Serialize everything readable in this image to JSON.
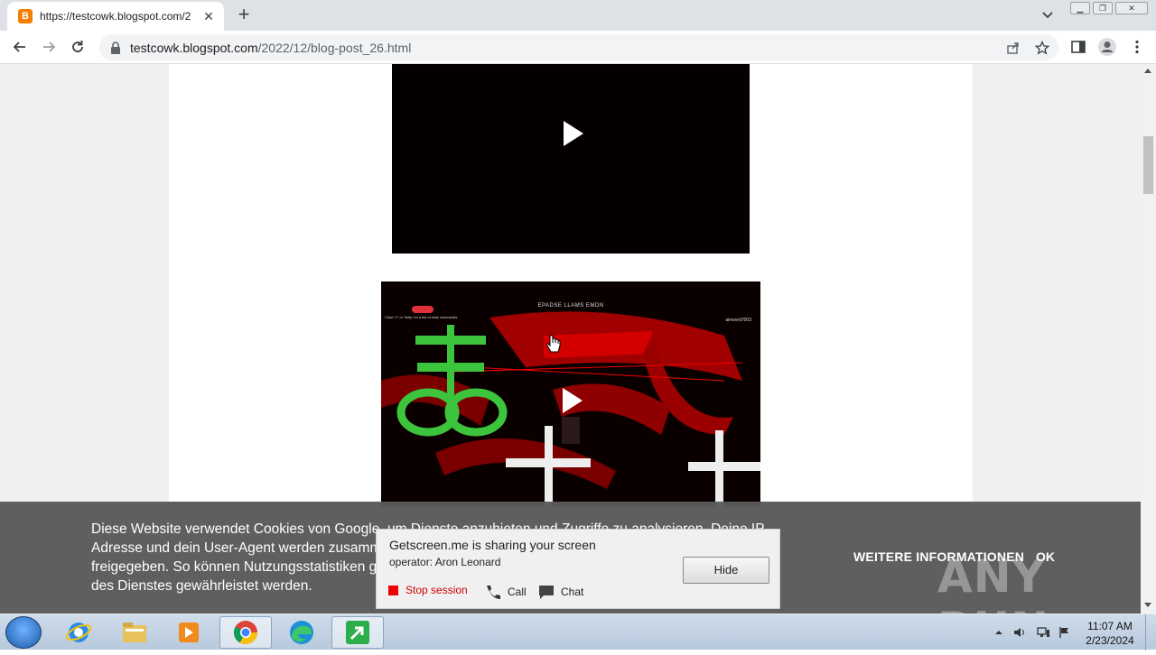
{
  "browser": {
    "tab_title": "https://testcowk.blogspot.com/2",
    "favicon_letter": "B",
    "new_tab_label": "+",
    "tab_close_label": "✕",
    "url_host": "testcowk.blogspot.com",
    "url_path": "/2022/12/blog-post_26.html"
  },
  "page": {
    "video2": {
      "title": "EPADSE LLAMS EMDN",
      "user": "aimsvrd7003",
      "note": "Clout '/?' or '/help' for a list of chat commands."
    },
    "cookie": {
      "text": "Diese Website verwendet Cookies von Google, um Dienste anzubieten und Zugriffe zu analysieren. Deine IP-Adresse und dein User-Agent werden zusammen mit Messwerten zur Leistung und Sicherheit für Google freigegeben. So können Nutzungsstatistiken generiert, Missbrauchsfälle erkannt und behoben und die Qualität des Dienstes gewährleistet werden.",
      "more_label": "WEITERE INFORMATIONEN",
      "ok_label": "OK"
    }
  },
  "getscreen": {
    "title": "Getscreen.me is sharing your screen",
    "operator": "operator: Aron Leonard",
    "hide_label": "Hide",
    "stop_label": "Stop session",
    "call_label": "Call",
    "chat_label": "Chat"
  },
  "watermark": "ANY RUN",
  "taskbar": {
    "time": "11:07 AM",
    "date": "2/23/2024",
    "apps": [
      "internet-explorer",
      "file-explorer",
      "media-player",
      "chrome",
      "edge",
      "anyrun-agent"
    ]
  },
  "colors": {
    "chrome_tab_bg": "#dee1e6",
    "cookie_bg": "#5a5a5a",
    "stop_red": "#e00000",
    "blogger_orange": "#f57d00"
  }
}
